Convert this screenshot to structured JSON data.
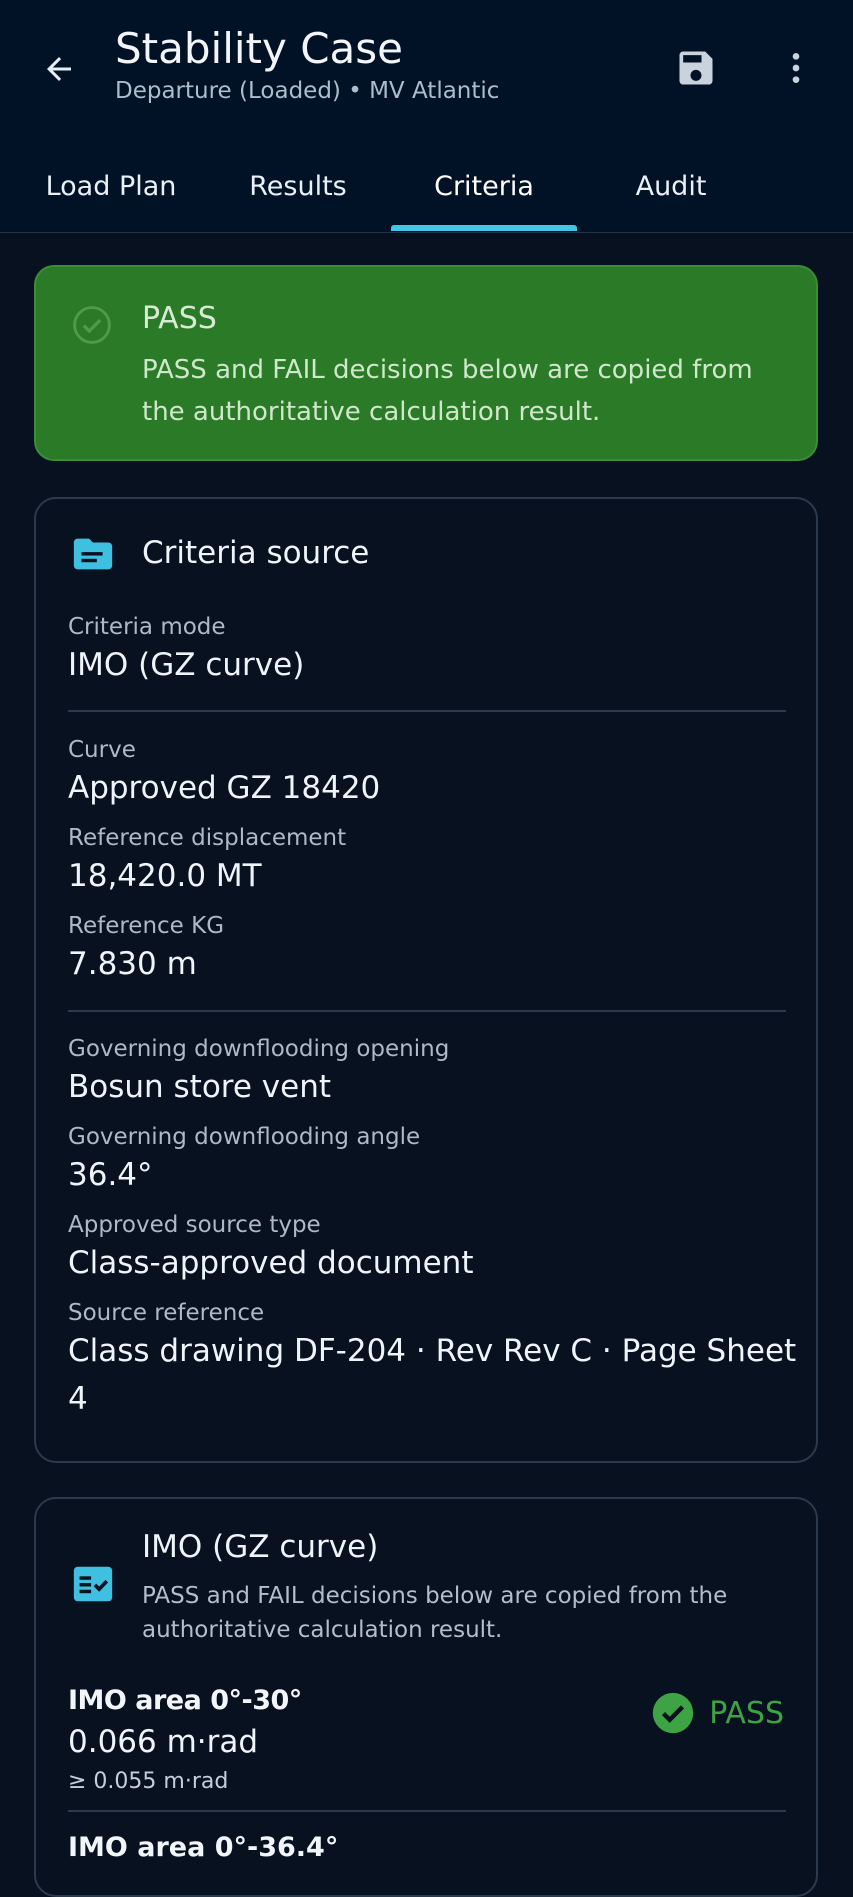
{
  "header": {
    "title": "Stability Case",
    "subtitle": "Departure (Loaded) • MV Atlantic",
    "back_icon": "arrow-left-icon",
    "save_icon": "save-icon",
    "more_icon": "more-vert-icon"
  },
  "tabs": [
    {
      "label": "Load Plan",
      "active": false
    },
    {
      "label": "Results",
      "active": false
    },
    {
      "label": "Criteria",
      "active": true
    },
    {
      "label": "Audit",
      "active": false
    }
  ],
  "banner": {
    "title": "PASS",
    "text": "PASS and FAIL decisions below are copied from the authoritative calculation result.",
    "color": "#2b7a28"
  },
  "criteria_source": {
    "title": "Criteria source",
    "fields": [
      {
        "label": "Criteria mode",
        "value": "IMO (GZ curve)"
      },
      {
        "label": "Curve",
        "value": "Approved GZ 18420"
      },
      {
        "label": "Reference displacement",
        "value": "18,420.0 MT"
      },
      {
        "label": "Reference KG",
        "value": "7.830 m"
      },
      {
        "label": "Governing downflooding opening",
        "value": "Bosun store vent"
      },
      {
        "label": "Governing downflooding angle",
        "value": "36.4°"
      },
      {
        "label": "Approved source type",
        "value": "Class-approved document"
      },
      {
        "label": "Source reference",
        "value": "Class drawing DF-204 · Rev Rev C · Page Sheet 4"
      }
    ]
  },
  "imo_card": {
    "title": "IMO (GZ curve)",
    "subtitle": "PASS and FAIL decisions below are copied from the authoritative calculation result.",
    "criteria": [
      {
        "name": "IMO area 0°-30°",
        "value": "0.066 m·rad",
        "requirement": "≥ 0.055 m·rad",
        "status": "PASS"
      },
      {
        "name": "IMO area 0°-36.4°"
      }
    ]
  },
  "colors": {
    "accent": "#43c6e6",
    "pass": "#3da345",
    "background": "#07111f",
    "appbar": "#021226"
  }
}
